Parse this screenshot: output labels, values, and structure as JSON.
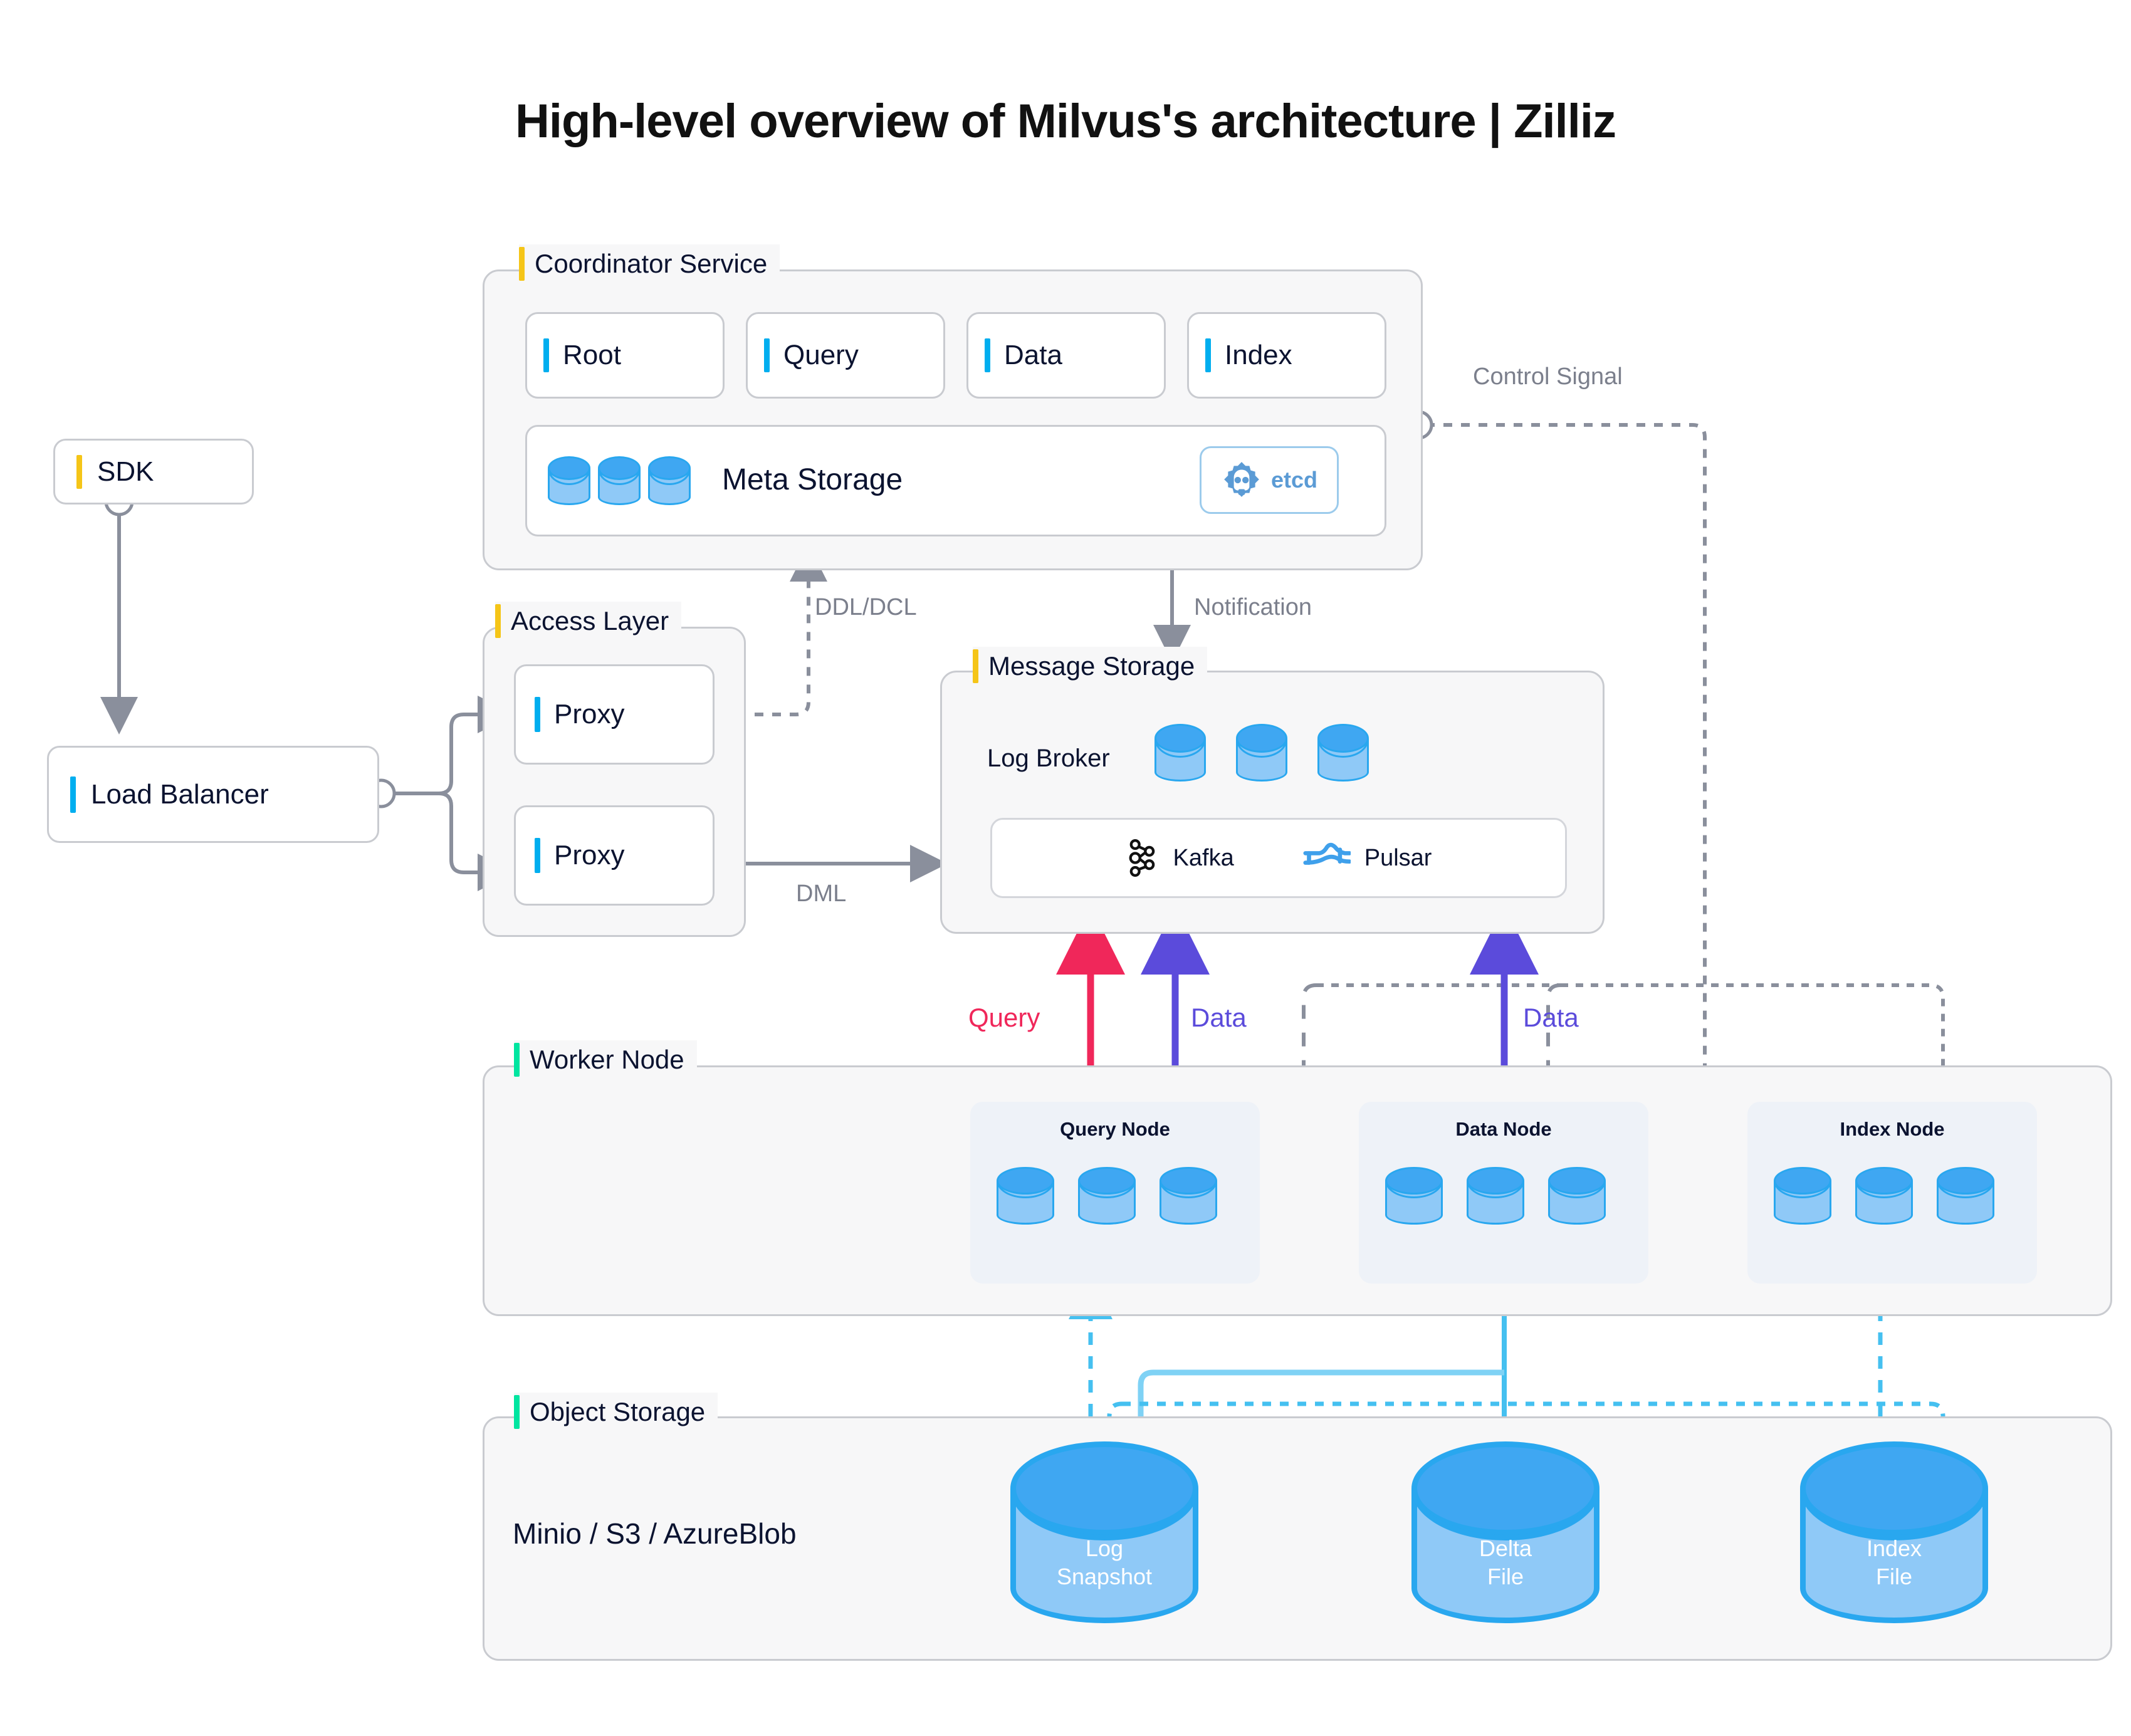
{
  "title": "High-level overview of Milvus's architecture | Zilliz",
  "colors": {
    "accent_yellow": "#F5C518",
    "accent_blue": "#00AEEF",
    "accent_green": "#00E5A0",
    "query_pink": "#F0275A",
    "data_purple": "#5B4BDB",
    "cylinder_light": "#8FC9F7",
    "cylinder_dark": "#3FA7F2",
    "cylinder_border": "#29A7EF",
    "etcd_blue": "#5B9BD5",
    "wire_gray": "#8A8F9C",
    "object_wire_blue": "#45C0F0"
  },
  "sdk": {
    "label": "SDK",
    "bar_color": "#F5C518"
  },
  "load_balancer": {
    "label": "Load Balancer",
    "bar_color": "#00AEEF"
  },
  "access_layer": {
    "label": "Access Layer",
    "bar_color": "#F5C518",
    "proxies": [
      {
        "label": "Proxy",
        "bar_color": "#00AEEF"
      },
      {
        "label": "Proxy",
        "bar_color": "#00AEEF"
      }
    ]
  },
  "coordinator_service": {
    "label": "Coordinator Service",
    "bar_color": "#F5C518",
    "coordinators": [
      {
        "label": "Root",
        "bar_color": "#00AEEF"
      },
      {
        "label": "Query",
        "bar_color": "#00AEEF"
      },
      {
        "label": "Data",
        "bar_color": "#00AEEF"
      },
      {
        "label": "Index",
        "bar_color": "#00AEEF"
      }
    ],
    "meta_storage": {
      "label": "Meta Storage",
      "cylinder_count": 3,
      "badge": {
        "label": "etcd",
        "icon": "etcd-gear-icon"
      }
    }
  },
  "message_storage": {
    "label": "Message Storage",
    "bar_color": "#F5C518",
    "log_broker": {
      "label": "Log Broker",
      "cylinder_count": 3
    },
    "brokers": [
      {
        "label": "Kafka",
        "icon": "kafka-icon",
        "icon_color": "#111111"
      },
      {
        "label": "Pulsar",
        "icon": "pulsar-icon",
        "icon_color": "#3FA0EB"
      }
    ]
  },
  "worker_node": {
    "label": "Worker Node",
    "bar_color": "#00E5A0",
    "nodes": [
      {
        "label": "Query Node",
        "cylinder_count": 3
      },
      {
        "label": "Data Node",
        "cylinder_count": 3
      },
      {
        "label": "Index Node",
        "cylinder_count": 3
      }
    ]
  },
  "object_storage": {
    "label": "Object Storage",
    "bar_color": "#00E5A0",
    "providers": "Minio / S3 / AzureBlob",
    "stores": [
      {
        "line1": "Log",
        "line2": "Snapshot"
      },
      {
        "line1": "Delta",
        "line2": "File"
      },
      {
        "line1": "Index",
        "line2": "File"
      }
    ]
  },
  "edge_labels": {
    "control_signal": "Control Signal",
    "ddl_dcl": "DDL/DCL",
    "notification": "Notification",
    "dml": "DML",
    "query": "Query",
    "data_left": "Data",
    "data_right": "Data"
  }
}
